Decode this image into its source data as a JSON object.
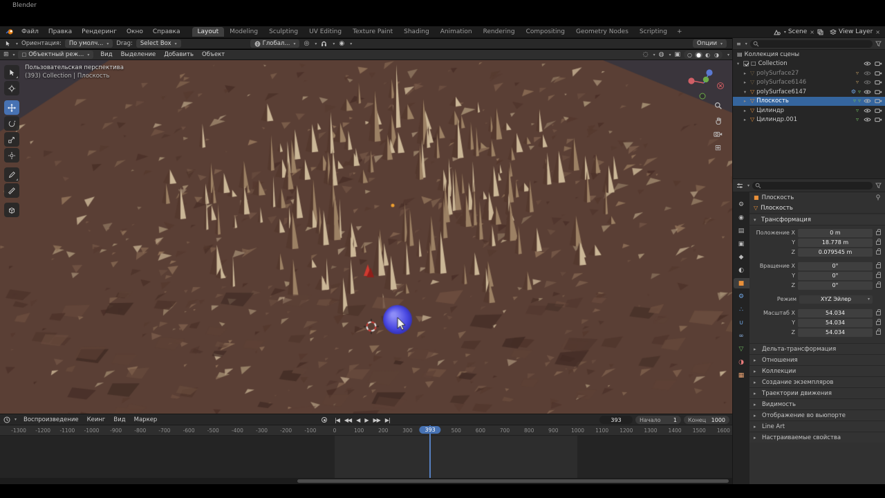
{
  "titlebar": {
    "app_title": "Blender"
  },
  "topbar": {
    "menus": [
      "Файл",
      "Правка",
      "Рендеринг",
      "Окно",
      "Справка"
    ],
    "workspaces": [
      {
        "label": "Layout",
        "active": true
      },
      {
        "label": "Modeling"
      },
      {
        "label": "Sculpting"
      },
      {
        "label": "UV Editing"
      },
      {
        "label": "Texture Paint"
      },
      {
        "label": "Shading"
      },
      {
        "label": "Animation"
      },
      {
        "label": "Rendering"
      },
      {
        "label": "Compositing"
      },
      {
        "label": "Geometry Nodes"
      },
      {
        "label": "Scripting"
      }
    ],
    "add_workspace": "+",
    "scene_selector": {
      "label": "Scene"
    },
    "view_layer_selector": {
      "label": "View Layer"
    }
  },
  "tool_settings": {
    "orientation_label": "Ориентация:",
    "orientation_value": "По умолч...",
    "drag_label": "Drag:",
    "drag_value": "Select Box",
    "transform_pivot": "Глобал...",
    "options_label": "Опции"
  },
  "viewport": {
    "header": {
      "mode_value": "Объектный реж...",
      "menus": [
        "Вид",
        "Выделение",
        "Добавить",
        "Объект"
      ]
    },
    "overlay": {
      "view_label": "Пользовательская перспектива",
      "context_label": "(393) Collection | Плоскость"
    },
    "scene": {
      "bg": "#3a353c",
      "ground": "#5a3f35",
      "facets": [
        "#6e5142",
        "#7d5f4c",
        "#8f7158",
        "#55392e",
        "#4a3028",
        "#a08a6f",
        "#c0ab8d"
      ],
      "fg": [
        "#4e342b",
        "#5d4136",
        "#422c25",
        "#6b4d3e"
      ],
      "spike_dark": "#54392e",
      "spike_mid": "#9c8164",
      "spike_light": "#cbb797",
      "tall_spikes": [
        [
          573,
          96,
          90
        ],
        [
          542,
          116,
          72
        ],
        [
          612,
          120,
          64
        ],
        [
          478,
          133,
          58
        ],
        [
          662,
          140,
          55
        ],
        [
          718,
          113,
          44
        ],
        [
          392,
          158,
          50
        ],
        [
          830,
          158,
          46
        ],
        [
          305,
          190,
          42
        ],
        [
          880,
          190,
          38
        ]
      ],
      "origin_color": "#f0a030",
      "red_object_color": "#cf3a30",
      "sphere_color": "#4a49e2",
      "sphere_highlight": "#8d8cf7",
      "sphere_shadow": "#2d2cae",
      "cursor_red": "#c8403a"
    }
  },
  "timeline": {
    "menus": [
      "Воспроизведение",
      "Кеинг",
      "Вид",
      "Маркер"
    ],
    "current_frame": "393",
    "start_label": "Начало",
    "start_value": "1",
    "end_label": "Конец",
    "end_value": "1000",
    "ticks": [
      "-1300",
      "-1200",
      "-1100",
      "-1000",
      "-900",
      "-800",
      "-700",
      "-600",
      "-500",
      "-400",
      "-300",
      "-200",
      "-100",
      "0",
      "100",
      "200",
      "300",
      "400",
      "500",
      "600",
      "700",
      "800",
      "900",
      "1000",
      "1100",
      "1200",
      "1300",
      "1400",
      "1500",
      "1600"
    ]
  },
  "outliner": {
    "scene_collection": "Коллекция сцены",
    "items": [
      {
        "label": "Collection",
        "pad": "3px",
        "arrow": "▾",
        "icon": "□",
        "icon_color": "#c9c9c9",
        "checkbox": true
      },
      {
        "label": "polySurface27",
        "pad": "13px",
        "arrow": "▸",
        "icon": "▽",
        "icon_color": "#b9975f",
        "dim": true,
        "b1": "▿",
        "b1c": "#b9975f"
      },
      {
        "label": "polySurface6146",
        "pad": "13px",
        "arrow": "▸",
        "icon": "▽",
        "icon_color": "#b9975f",
        "dim": true,
        "b1": "▿",
        "b1c": "#b9975f"
      },
      {
        "label": "polySurface6147",
        "pad": "13px",
        "arrow": "▾",
        "icon": "▽",
        "icon_color": "#e8903a",
        "b1": "⚙",
        "b1c": "#71a8e8",
        "b2": "▿",
        "b2c": "#6fba5f"
      },
      {
        "label": "Плоскость",
        "pad": "13px",
        "arrow": "▸",
        "icon": "▽",
        "icon_color": "#e8903a",
        "selected": true,
        "b1": "▿",
        "b1c": "#6fba5f",
        "b2": "▿",
        "b2c": "#6fba5f"
      },
      {
        "label": "Цилиндр",
        "pad": "13px",
        "arrow": "▸",
        "icon": "▽",
        "icon_color": "#e8903a",
        "b1": "▿",
        "b1c": "#6fba5f"
      },
      {
        "label": "Цилиндр.001",
        "pad": "13px",
        "arrow": "▸",
        "icon": "▽",
        "icon_color": "#e8903a",
        "b1": "▿",
        "b1c": "#6fba5f"
      }
    ]
  },
  "properties": {
    "tabs": [
      {
        "name": "tool",
        "glyph": "⚙",
        "color": "#b9b9b9"
      },
      {
        "name": "render",
        "glyph": "◉",
        "color": "#b9b9b9"
      },
      {
        "name": "output",
        "glyph": "▤",
        "color": "#b9b9b9"
      },
      {
        "name": "view-layer",
        "glyph": "▣",
        "color": "#b9b9b9"
      },
      {
        "name": "scene",
        "glyph": "◆",
        "color": "#b9b9b9"
      },
      {
        "name": "world",
        "glyph": "◐",
        "color": "#b9b9b9"
      },
      {
        "name": "object",
        "glyph": "■",
        "color": "#e8903a",
        "active": true
      },
      {
        "name": "modifiers",
        "glyph": "⚙",
        "color": "#71a8e8"
      },
      {
        "name": "particles",
        "glyph": "∴",
        "color": "#71a8e8"
      },
      {
        "name": "physics",
        "glyph": "∪",
        "color": "#71a8e8"
      },
      {
        "name": "constraints",
        "glyph": "∞",
        "color": "#8fb7e8"
      },
      {
        "name": "object-data",
        "glyph": "▽",
        "color": "#6fba5f"
      },
      {
        "name": "material",
        "glyph": "◑",
        "color": "#e87b7b"
      },
      {
        "name": "texture",
        "glyph": "▦",
        "color": "#e8a171"
      }
    ],
    "breadcrumb": {
      "object": "Плоскость"
    },
    "name_field": "Плоскость",
    "transform": {
      "title": "Трансформация",
      "rows": [
        {
          "label": "Положение X",
          "value": "0 m"
        },
        {
          "label": "Y",
          "value": "18.778 m"
        },
        {
          "label": "Z",
          "value": "0.079545 m"
        },
        {
          "label": "Вращение X",
          "value": "0°",
          "group": true
        },
        {
          "label": "Y",
          "value": "0°"
        },
        {
          "label": "Z",
          "value": "0°"
        },
        {
          "label": "Режим",
          "value": "XYZ Эйлер",
          "dropdown": true,
          "group": true
        },
        {
          "label": "Масштаб X",
          "value": "54.034",
          "group": true
        },
        {
          "label": "Y",
          "value": "54.034"
        },
        {
          "label": "Z",
          "value": "54.034"
        }
      ]
    },
    "collapsed_sections": [
      "Дельта-трансформация",
      "Отношения",
      "Коллекции",
      "Создание экземпляров",
      "Траектории движения",
      "Видимость",
      "Отображение во вьюпорте",
      "Line Art",
      "Настраиваемые свойства"
    ]
  },
  "colors": {
    "accent": "#4772b3",
    "object_orange": "#e8903a",
    "mesh_green": "#6fba5f",
    "selection_row": "#35659e"
  }
}
